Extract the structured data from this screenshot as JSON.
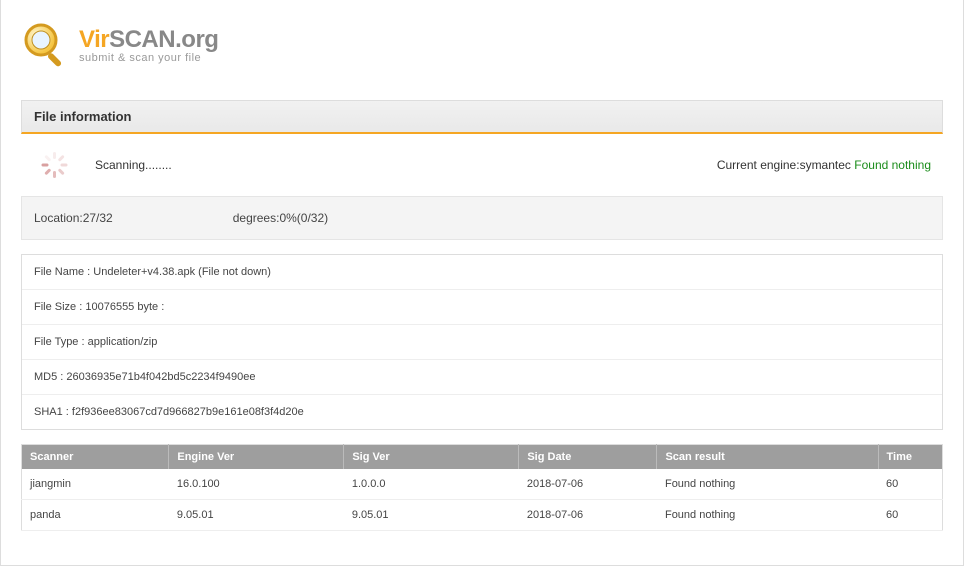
{
  "logo": {
    "vir": "Vir",
    "scan": "SCAN",
    "org": ".org",
    "sub": "submit & scan your file"
  },
  "section_title": "File information",
  "scan": {
    "scanning_label": "Scanning........",
    "current_engine_label": "Current engine:",
    "current_engine": "symantec",
    "current_result": "Found nothing"
  },
  "progress": {
    "location_label": "Location:",
    "location_value": "27/32",
    "degrees_label": "degrees:",
    "degrees_value": "0%(0/32)"
  },
  "file": {
    "name_label": "File Name : ",
    "name_value": "Undeleter+v4.38.apk (File not down)",
    "size_label": "File Size : ",
    "size_value": "10076555 byte :",
    "type_label": "File Type : ",
    "type_value": "application/zip",
    "md5_label": "MD5 : ",
    "md5_value": "26036935e71b4f042bd5c2234f9490ee",
    "sha1_label": "SHA1 : ",
    "sha1_value": "f2f936ee83067cd7d966827b9e161e08f3f4d20e"
  },
  "table": {
    "headers": {
      "scanner": "Scanner",
      "engine": "Engine Ver",
      "sig": "Sig Ver",
      "date": "Sig Date",
      "result": "Scan result",
      "time": "Time"
    },
    "rows": [
      {
        "scanner": "jiangmin",
        "engine": "16.0.100",
        "sig": "1.0.0.0",
        "date": "2018-07-06",
        "result": "Found nothing",
        "time": "60"
      },
      {
        "scanner": "panda",
        "engine": "9.05.01",
        "sig": "9.05.01",
        "date": "2018-07-06",
        "result": "Found nothing",
        "time": "60"
      }
    ]
  }
}
